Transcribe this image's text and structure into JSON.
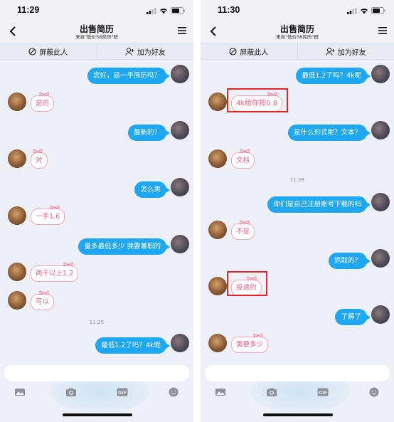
{
  "screens": [
    {
      "status": {
        "time": "11:29"
      },
      "header": {
        "title": "出售简历",
        "subtitle": "来自\"低价58简历\"群"
      },
      "actions": {
        "block": "屏蔽此人",
        "add_friend": "加为好友"
      },
      "messages": [
        {
          "side": "me",
          "text": "您好，是一手简历吗？"
        },
        {
          "side": "other",
          "text": "是的"
        },
        {
          "side": "me",
          "text": "最新的？"
        },
        {
          "side": "other",
          "text": "对"
        },
        {
          "side": "me",
          "text": "怎么卖"
        },
        {
          "side": "other",
          "text": "一手1.6"
        },
        {
          "side": "me",
          "text": "量多最低多少 我要兼职的"
        },
        {
          "side": "other",
          "text": "两千以上1.2"
        },
        {
          "side": "other",
          "text": "可以"
        },
        {
          "side": "timestamp",
          "text": "11:25"
        },
        {
          "side": "me",
          "text": "最低1.2了吗？4k呢"
        }
      ]
    },
    {
      "status": {
        "time": "11:30"
      },
      "header": {
        "title": "出售简历",
        "subtitle": "来自\"低价58简历\"群"
      },
      "actions": {
        "block": "屏蔽此人",
        "add_friend": "加为好友"
      },
      "messages": [
        {
          "side": "me",
          "text": "最低1.2了吗？4k呢"
        },
        {
          "side": "other",
          "text": "4k给你按0.8",
          "highlighted": true
        },
        {
          "side": "me",
          "text": "是什么形式呢？文本？"
        },
        {
          "side": "other",
          "text": "文档"
        },
        {
          "side": "timestamp",
          "text": "11:28"
        },
        {
          "side": "me",
          "text": "你们是自己注册账号下载的吗"
        },
        {
          "side": "other",
          "text": "不是"
        },
        {
          "side": "me",
          "text": "抓取的？"
        },
        {
          "side": "other",
          "text": "投递的",
          "highlighted": true
        },
        {
          "side": "me",
          "text": "了解了"
        },
        {
          "side": "other",
          "text": "需要多少"
        }
      ]
    }
  ],
  "toolbar_icons": [
    "image-icon",
    "camera-icon",
    "gif-icon",
    "emoji-icon"
  ],
  "gif_label": "GIF",
  "colors": {
    "my_bubble": "#1ea7f2",
    "other_text": "#ef5f84",
    "highlight": "#e3262d"
  }
}
